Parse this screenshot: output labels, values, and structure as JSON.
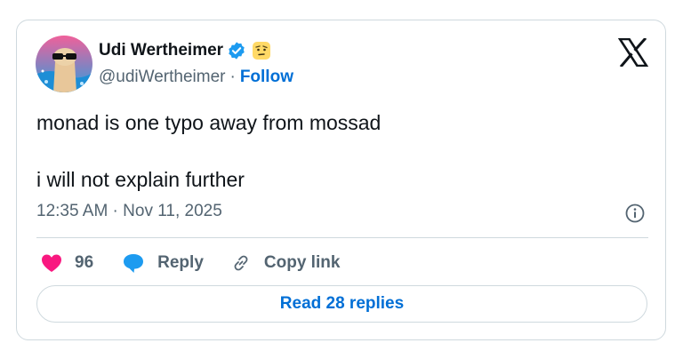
{
  "author": {
    "display_name": "Udi Wertheimer",
    "handle": "@udiWertheimer",
    "separator": "·",
    "follow_label": "Follow",
    "verified_badge_icon": "verified-check-icon",
    "name_emoji_icon": "raised-eyebrow-face-icon"
  },
  "tweet": {
    "lines": [
      "monad is one typo away from mossad",
      "i will not explain further"
    ],
    "timestamp": "12:35 AM · Nov 11, 2025"
  },
  "actions": {
    "like_count": "96",
    "reply_label": "Reply",
    "copy_label": "Copy link"
  },
  "footer": {
    "read_replies_label": "Read 28 replies"
  },
  "colors": {
    "link_blue": "#006fd6",
    "verified_blue": "#1d9bf0",
    "like_pink": "#f91880",
    "reply_blue": "#1d9bf0",
    "text_primary": "#0f1419",
    "text_secondary": "#536471",
    "border": "#cfd9de"
  }
}
